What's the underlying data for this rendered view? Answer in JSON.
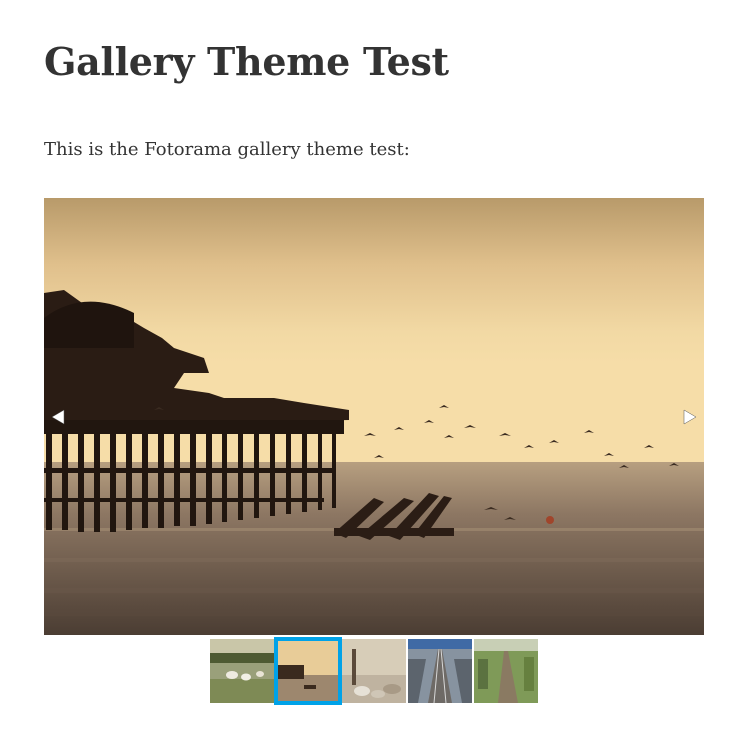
{
  "post": {
    "title": "Gallery Theme Test",
    "intro": "This is the Fotorama gallery theme test:"
  },
  "gallery": {
    "active_index": 1,
    "prev_icon": "triangle-left-icon",
    "next_icon": "triangle-right-icon",
    "accent_color": "#00a2e8",
    "thumbnails": [
      {
        "subject": "sheep-in-field"
      },
      {
        "subject": "ruined-pier-at-sunset"
      },
      {
        "subject": "stones-on-beach"
      },
      {
        "subject": "railway-tracks"
      },
      {
        "subject": "grassy-path"
      }
    ]
  }
}
